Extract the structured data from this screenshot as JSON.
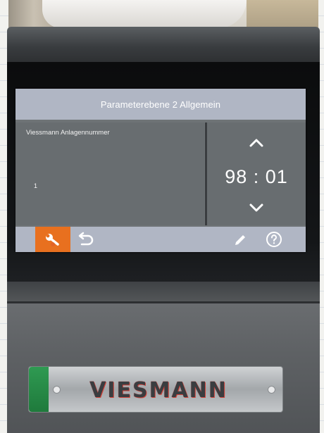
{
  "display": {
    "title": "Parameterebene 2 Allgemein",
    "parameter_name": "Viessmann Anlagennummer",
    "parameter_value": "1",
    "code_value": "98 : 01",
    "icons": {
      "up": "chevron-up-icon",
      "down": "chevron-down-icon",
      "service": "wrench-icon",
      "back": "back-arrow-icon",
      "edit": "pencil-icon",
      "help": "question-mark-icon"
    }
  },
  "logo": {
    "text": "VIESMANN"
  },
  "colors": {
    "header_bar": "#b0b6c4",
    "panel": "#686d70",
    "service_button": "#e8701f",
    "logo_green": "#2f9a52",
    "logo_red": "#d1453c"
  }
}
